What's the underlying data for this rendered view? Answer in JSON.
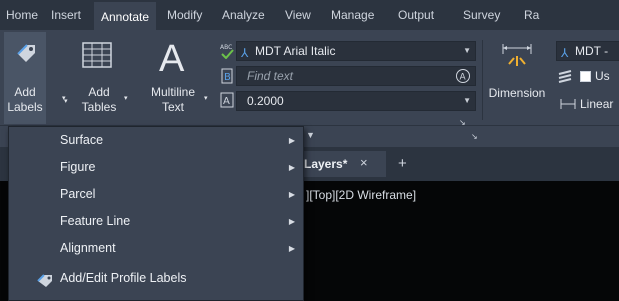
{
  "tabs": [
    "Home",
    "Insert",
    "Annotate",
    "Modify",
    "Analyze",
    "View",
    "Manage",
    "Output",
    "Survey",
    "Ra"
  ],
  "active_tab": "Annotate",
  "ribbon": {
    "add_labels": [
      "Add",
      "Labels"
    ],
    "add_tables": [
      "Add",
      "Tables"
    ],
    "multiline_text": [
      "Multiline",
      "Text"
    ],
    "text_style": "MDT Arial Italic",
    "find_text_placeholder": "Find text",
    "text_height": "0.2000",
    "dimension": "Dimension",
    "dim_style": "MDT -",
    "use_label": "Us",
    "linear_label": "Linear"
  },
  "doc_tab": {
    "title": "Layers*",
    "close": "×",
    "add": "+"
  },
  "viewport_label": "][Top][2D Wireframe]",
  "menu": {
    "items": [
      {
        "label": "Surface",
        "has_submenu": true
      },
      {
        "label": "Figure",
        "has_submenu": true
      },
      {
        "label": "Parcel",
        "has_submenu": true
      },
      {
        "label": "Feature Line",
        "has_submenu": true
      },
      {
        "label": "Alignment",
        "has_submenu": true
      },
      {
        "label": "Add/Edit Profile Labels",
        "has_submenu": false
      }
    ]
  },
  "colors": {
    "accent": "#5aa0e6",
    "panel": "#3b4453",
    "tabbar": "#2c3440",
    "canvas": "#050607",
    "checkmark": "#6cc24a"
  }
}
